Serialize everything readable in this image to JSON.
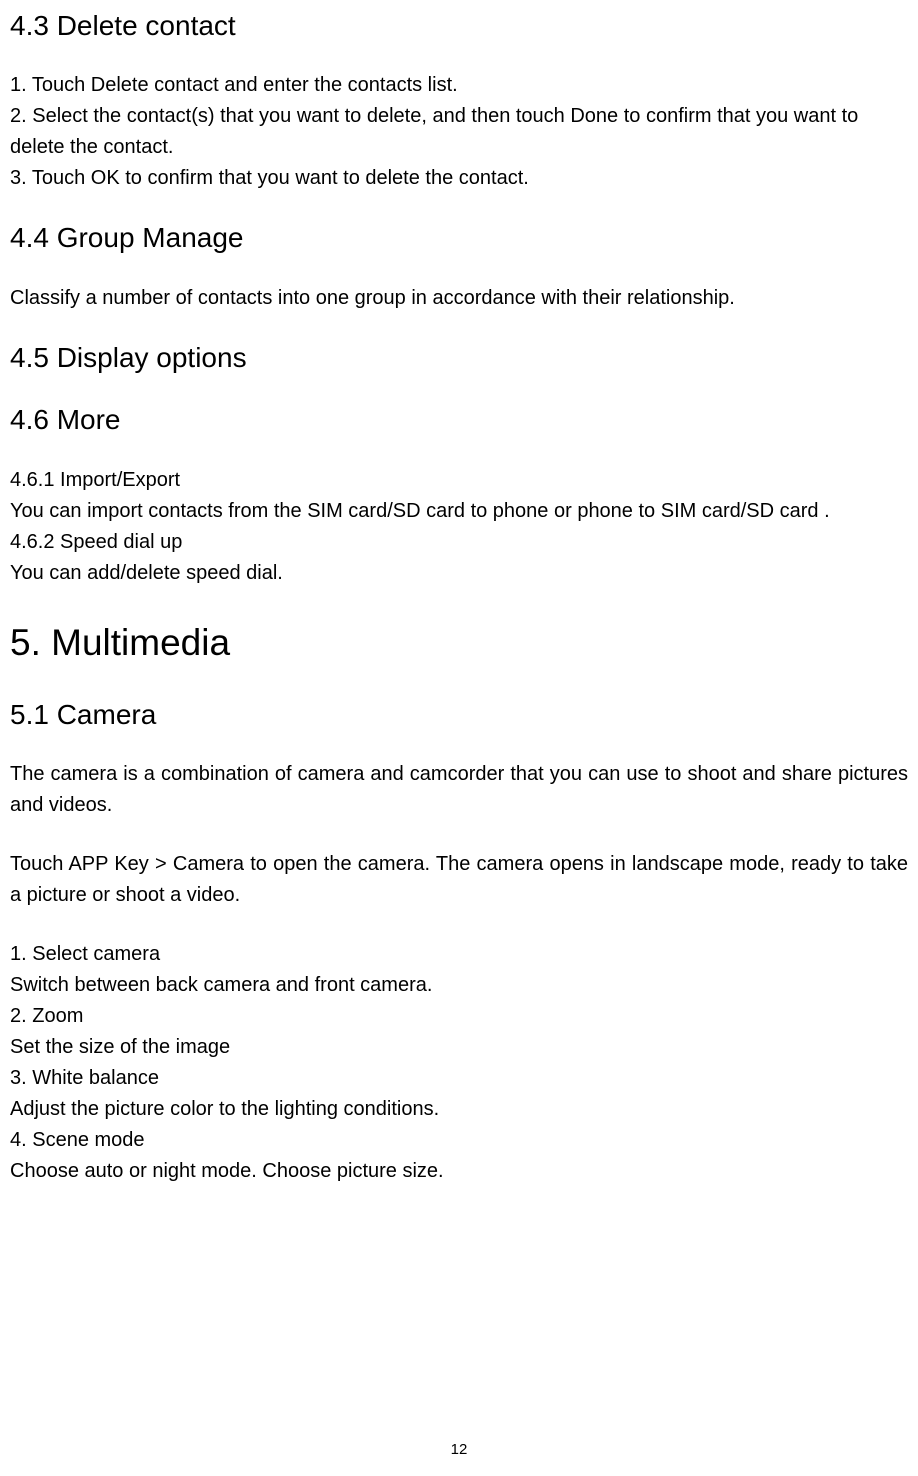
{
  "s43": {
    "title": "4.3 Delete contact",
    "line1": "1. Touch Delete contact and enter the contacts list.",
    "line2": "2. Select the contact(s) that you want to delete, and then touch Done to confirm that you want to delete the contact.",
    "line3": "3. Touch OK to confirm that you want to delete the contact."
  },
  "s44": {
    "title": "4.4 Group Manage",
    "body": "Classify a number of contacts into one group in accordance with their relationship."
  },
  "s45": {
    "title": "4.5 Display options"
  },
  "s46": {
    "title": "4.6 More",
    "sub1_title": "4.6.1 Import/Export",
    "sub1_body": "You can import contacts from the SIM card/SD card to phone or phone to SIM card/SD card .",
    "sub2_title": "4.6.2 Speed dial up",
    "sub2_body": "You can add/delete speed dial."
  },
  "s5": {
    "title": "5. Multimedia"
  },
  "s51": {
    "title": "5.1 Camera",
    "p1": "The camera is a combination of camera and camcorder that you can use to shoot and share pictures and videos.",
    "p2": "Touch APP Key > Camera to open the camera. The camera opens in landscape mode, ready to take a picture or shoot a video.",
    "i1_title": "1. Select camera",
    "i1_body": "Switch between back camera and front camera.",
    "i2_title": "2. Zoom",
    "i2_body": "Set the size of the image",
    "i3_title": "3. White balance",
    "i3_body": "Adjust the picture color to the lighting conditions.",
    "i4_title": "4. Scene mode",
    "i4_body": "Choose auto or night mode. Choose picture size."
  },
  "page_number": "12"
}
